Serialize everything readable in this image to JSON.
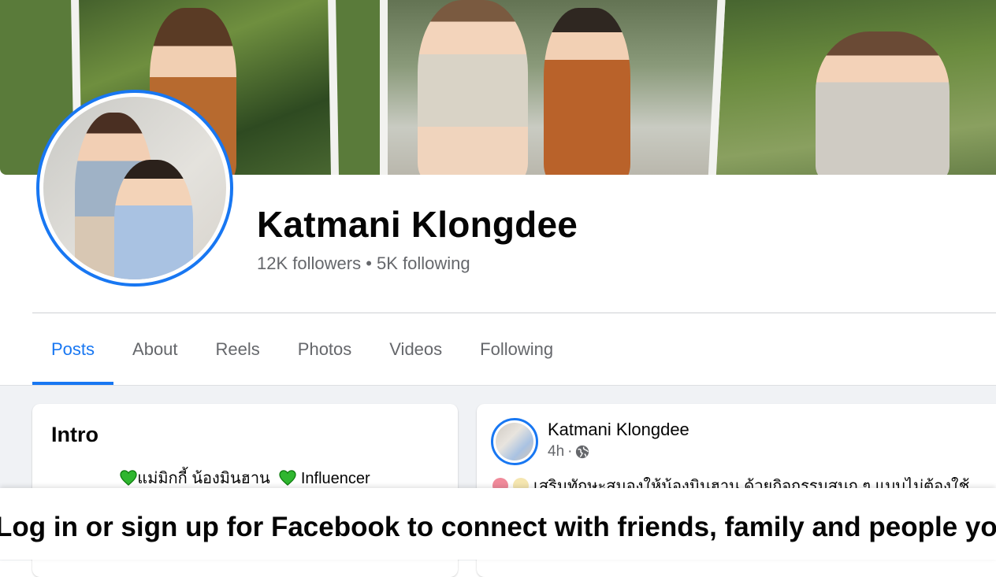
{
  "profile": {
    "name": "Katmani Klongdee",
    "followers": "12K followers",
    "separator": "•",
    "following": "5K following"
  },
  "tabs": [
    {
      "label": "Posts",
      "active": true
    },
    {
      "label": "About",
      "active": false
    },
    {
      "label": "Reels",
      "active": false
    },
    {
      "label": "Photos",
      "active": false
    },
    {
      "label": "Videos",
      "active": false
    },
    {
      "label": "Following",
      "active": false
    }
  ],
  "intro": {
    "title": "Intro",
    "bio_part1": "แม่มิกกี้ น้องมินฮาน",
    "bio_part2": "Influencer"
  },
  "post": {
    "author": "Katmani Klongdee",
    "time": "4h",
    "dot": "·",
    "text": "เสริมทักษะสมองให้น้องมินฮาน ด้วยกิจกรรมสนุก ๆ แบบไม่ต้องใช้"
  },
  "login_banner": {
    "text": "Log in or sign up for Facebook to connect with friends, family and people you know."
  },
  "icons": {
    "heart": "green-heart-icon",
    "globe": "globe-icon"
  },
  "colors": {
    "accent": "#1877f2",
    "secondary_text": "#65676b",
    "page_bg": "#f0f2f5",
    "heart": "#2fb62f"
  }
}
